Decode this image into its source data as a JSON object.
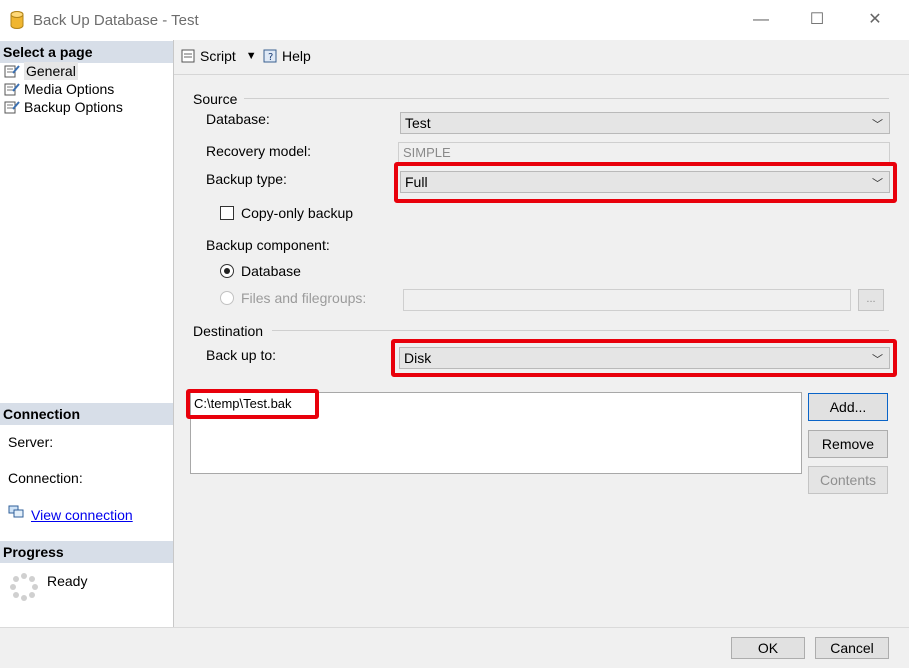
{
  "window": {
    "title": "Back Up Database - Test",
    "controls": {
      "minimize": "—",
      "maximize": "☐",
      "close": "✕"
    }
  },
  "left": {
    "select_page_header": "Select a page",
    "pages": [
      {
        "label": "General",
        "selected": true,
        "icon": "page-wrench-icon"
      },
      {
        "label": "Media Options",
        "icon": "page-wrench-icon"
      },
      {
        "label": "Backup Options",
        "icon": "page-wrench-icon"
      }
    ],
    "connection_header": "Connection",
    "server_label": "Server:",
    "connection_label": "Connection:",
    "view_connection": "View connection",
    "progress_header": "Progress",
    "progress_status": "Ready"
  },
  "toolbar": {
    "script_label": "Script",
    "help_label": "Help"
  },
  "source": {
    "title": "Source",
    "database_label": "Database:",
    "database_value": "Test",
    "recovery_label": "Recovery model:",
    "recovery_value": "SIMPLE",
    "backup_type_label": "Backup type:",
    "backup_type_value": "Full",
    "copy_only_label": "Copy-only backup",
    "copy_only_checked": false,
    "component_label": "Backup component:",
    "component_database": "Database",
    "component_files": "Files and filegroups:",
    "files_browse": "..."
  },
  "destination": {
    "title": "Destination",
    "back_up_to_label": "Back up to:",
    "back_up_to_value": "Disk",
    "paths": [
      "C:\\temp\\Test.bak"
    ],
    "add_button": "Add...",
    "remove_button": "Remove",
    "contents_button": "Contents"
  },
  "footer": {
    "ok_button": "OK",
    "cancel_button": "Cancel"
  },
  "colors": {
    "highlight": "#e8000b",
    "section_header_bg": "#d7dee8",
    "panel_bg": "#f0f0f0",
    "link": "#0000ee"
  }
}
